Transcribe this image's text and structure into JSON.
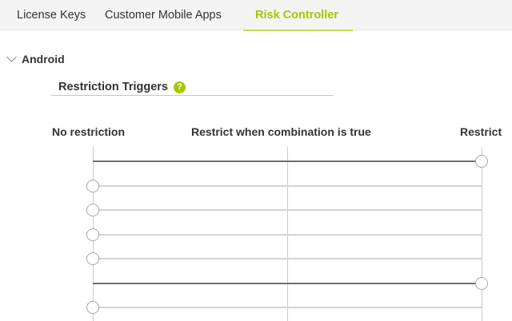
{
  "tabs": [
    {
      "label": "License Keys",
      "active": false
    },
    {
      "label": "Customer Mobile Apps",
      "active": false
    },
    {
      "label": "Risk Controller",
      "active": true
    }
  ],
  "colors": {
    "accent": "#a8c500",
    "underline": "#c7dc55"
  },
  "section": {
    "title": "Android",
    "expanded": true,
    "icon": "chevron-down-icon"
  },
  "restriction_triggers": {
    "title": "Restriction Triggers",
    "help_icon": "question-circle-icon",
    "help_glyph": "?"
  },
  "columns": {
    "no_restriction": "No restriction",
    "combination": "Restrict when combination is true",
    "restrict": "Restrict"
  },
  "sliders": [
    {
      "value": "Restrict"
    },
    {
      "value": "No restriction"
    },
    {
      "value": "No restriction"
    },
    {
      "value": "No restriction"
    },
    {
      "value": "No restriction"
    },
    {
      "value": "Restrict"
    },
    {
      "value": "No restriction"
    }
  ]
}
